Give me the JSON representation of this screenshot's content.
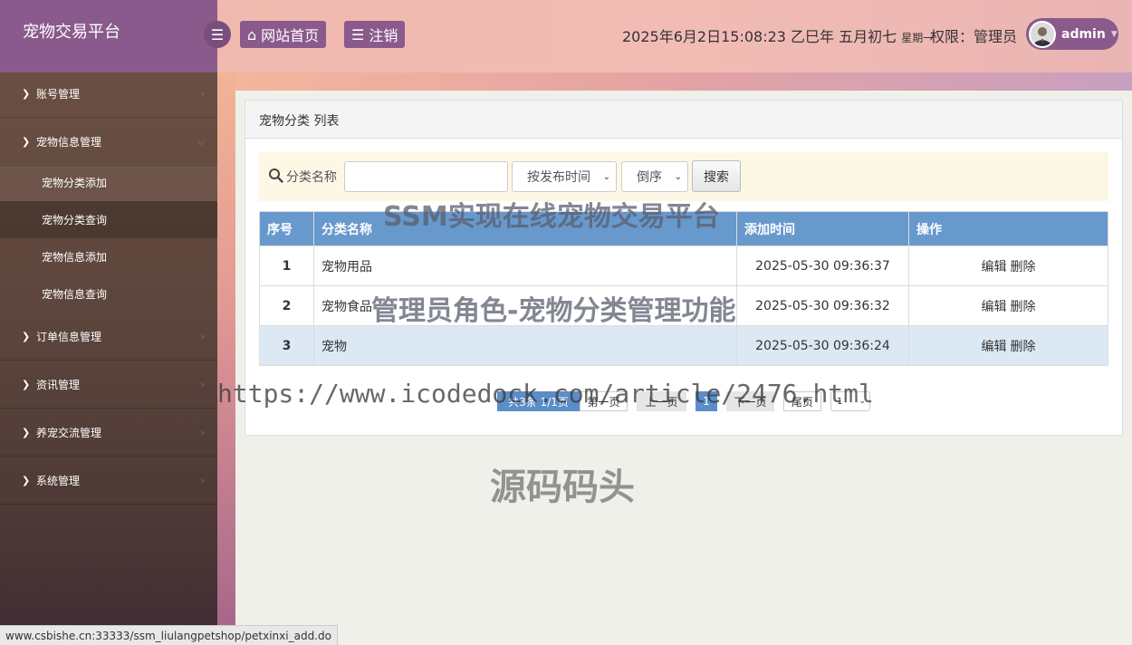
{
  "header": {
    "brand": "宠物交易平台",
    "home_label": "网站首页",
    "logout_label": "注销",
    "datetime": "2025年6月2日15:08:23 乙巳年 五月初七",
    "weekday": "星期一",
    "permission": "权限：管理员",
    "username": "admin"
  },
  "sidebar": {
    "items": [
      {
        "label": "账号管理"
      },
      {
        "label": "宠物信息管理"
      },
      {
        "label": "订单信息管理"
      },
      {
        "label": "资讯管理"
      },
      {
        "label": "养宠交流管理"
      },
      {
        "label": "系统管理"
      }
    ],
    "subitems": [
      {
        "label": "宠物分类添加"
      },
      {
        "label": "宠物分类查询"
      },
      {
        "label": "宠物信息添加"
      },
      {
        "label": "宠物信息查询"
      }
    ]
  },
  "panel": {
    "title": "宠物分类 列表",
    "search": {
      "label": "分类名称",
      "input_value": "",
      "sort_selected": "按发布时间",
      "order_selected": "倒序",
      "button": "搜索"
    },
    "table": {
      "columns": [
        "序号",
        "分类名称",
        "添加时间",
        "操作"
      ],
      "rows": [
        {
          "no": "1",
          "name": "宠物用品",
          "time": "2025-05-30 09:36:37",
          "edit": "编辑",
          "delete": "删除"
        },
        {
          "no": "2",
          "name": "宠物食品",
          "time": "2025-05-30 09:36:32",
          "edit": "编辑",
          "delete": "删除"
        },
        {
          "no": "3",
          "name": "宠物",
          "time": "2025-05-30 09:36:24",
          "edit": "编辑",
          "delete": "删除"
        }
      ]
    },
    "pager": {
      "total": "共3条 1/1页",
      "first": "第一页",
      "prev": "上一页",
      "current": "1",
      "next": "下一页",
      "last": "尾页",
      "page_select": "1"
    }
  },
  "watermarks": {
    "line1": "SSM实现在线宠物交易平台",
    "line2": "管理员角色-宠物分类管理功能",
    "url": "https://www.icodedock.com/article/2476.html",
    "brand": "源码码头"
  },
  "statusbar": "www.csbishe.cn:33333/ssm_liulangpetshop/petxinxi_add.do",
  "colors": {
    "accent_purple": "#8a5a8c",
    "table_header": "#6899cd",
    "pager_blue": "#5b8dc8"
  }
}
